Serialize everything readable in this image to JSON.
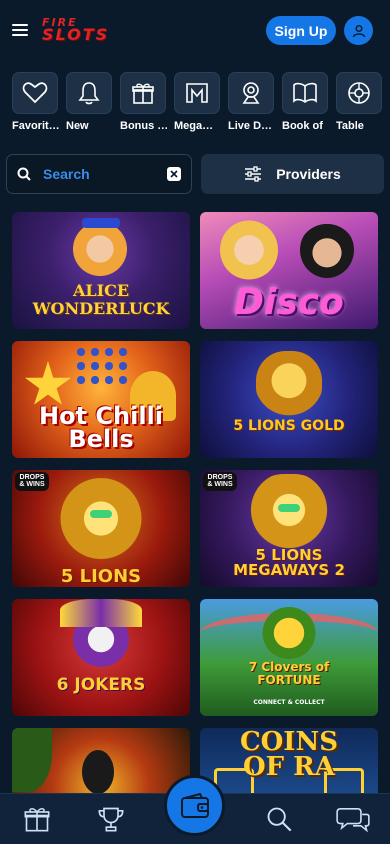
{
  "header": {
    "logo_line1": "FIRE",
    "logo_line2": "SLOTS",
    "signup_label": "Sign Up"
  },
  "categories": [
    {
      "label": "Favorit…",
      "icon": "heart-icon"
    },
    {
      "label": "New",
      "icon": "bell-icon"
    },
    {
      "label": "Bonus …",
      "icon": "gift-icon"
    },
    {
      "label": "Mega…",
      "icon": "mega-icon"
    },
    {
      "label": "Live D…",
      "icon": "live-dealer-icon"
    },
    {
      "label": "Book of",
      "icon": "book-icon"
    },
    {
      "label": "Table",
      "icon": "roulette-icon"
    }
  ],
  "search": {
    "label": "Search"
  },
  "providers": {
    "label": "Providers"
  },
  "games": [
    {
      "title": "ALICE WONDERLUCK"
    },
    {
      "title": "Disco"
    },
    {
      "title": "Hot Chilli Bells"
    },
    {
      "title": "5 LIONS GOLD"
    },
    {
      "title": "5 LIONS",
      "badge": "DROPS & WINS"
    },
    {
      "title": "5 LIONS MEGAWAYS 2",
      "badge": "DROPS & WINS"
    },
    {
      "title": "6 JOKERS"
    },
    {
      "title": "7 Clovers of FORTUNE",
      "subtitle": "CONNECT & COLLECT"
    },
    {
      "title": ""
    },
    {
      "title": "COINS OF RA"
    }
  ],
  "bottom_nav": [
    "gift-icon",
    "trophy-icon",
    "wallet-icon",
    "search-icon",
    "chat-icon"
  ],
  "colors": {
    "accent": "#1577e6",
    "background": "#0b1a2b",
    "brand_red": "#e02424"
  }
}
